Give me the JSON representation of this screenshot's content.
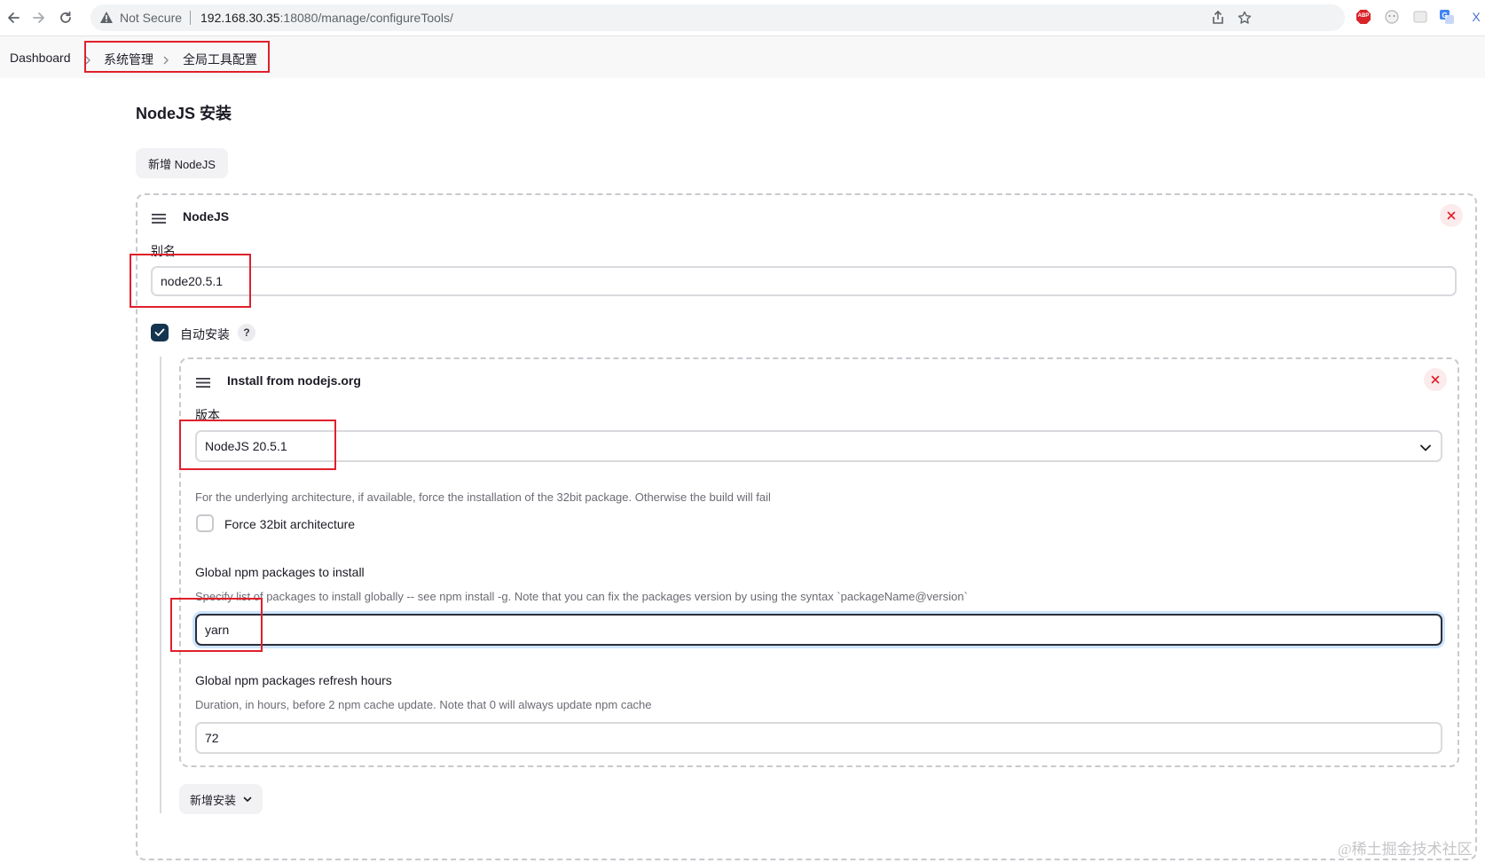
{
  "browser": {
    "security_label": "Not Secure",
    "url_host": "192.168.30.35",
    "url_rest": ":18080/manage/configureTools/",
    "extension_abp_label": "ABP",
    "extension_cut_label": "X"
  },
  "breadcrumb": {
    "items": [
      {
        "label": "Dashboard"
      },
      {
        "label": "系统管理"
      },
      {
        "label": "全局工具配置"
      }
    ]
  },
  "section": {
    "title": "NodeJS 安装",
    "add_button_label": "新增 NodeJS"
  },
  "nodejs_card": {
    "title": "NodeJS",
    "alias_label": "别名",
    "alias_value": "node20.5.1",
    "auto_install_label": "自动安装",
    "auto_install_checked": true,
    "help_label": "?"
  },
  "installer_card": {
    "title": "Install from nodejs.org",
    "version_label": "版本",
    "version_value": "NodeJS 20.5.1",
    "arch_description": "For the underlying architecture, if available, force the installation of the 32bit package. Otherwise the build will fail",
    "force32_label": "Force 32bit architecture",
    "force32_checked": false,
    "npm_packages_label": "Global npm packages to install",
    "npm_packages_description": "Specify list of packages to install globally -- see npm install -g. Note that you can fix the packages version by using the syntax `packageName@version`",
    "npm_packages_value": "yarn",
    "refresh_label": "Global npm packages refresh hours",
    "refresh_description": "Duration, in hours, before 2 npm cache update. Note that 0 will always update npm cache",
    "refresh_value": "72"
  },
  "add_installer_label": "新增安装",
  "watermark": "@稀土掘金技术社区",
  "colors": {
    "highlight_red": "#e0202b",
    "checkbox_checked": "#14344f",
    "close_icon": "#e0202b"
  }
}
